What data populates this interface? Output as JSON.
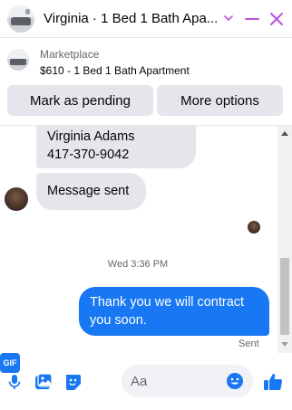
{
  "header": {
    "title": "Virginia · 1 Bed 1 Bath Apa...",
    "icons": [
      "chevron-down-icon",
      "minimize-icon",
      "close-icon"
    ],
    "accent_color": "#bc50e0"
  },
  "marketplace": {
    "label": "Marketplace",
    "item": "$610 - 1 Bed 1 Bath Apartment"
  },
  "actions": {
    "mark_pending": "Mark as pending",
    "more_options": "More options"
  },
  "messages": {
    "contact_name": "Virginia Adams",
    "contact_phone": "417-370-9042",
    "incoming": "Message sent",
    "timestamp": "Wed 3:36 PM",
    "outgoing": "Thank you we will contract you soon.",
    "status": "Sent"
  },
  "composer": {
    "placeholder": "Aa",
    "gif_label": "GIF",
    "icons": [
      "microphone-icon",
      "photo-icon",
      "sticker-icon",
      "gif-icon",
      "emoji-icon",
      "thumbs-up-icon"
    ],
    "accent_color": "#1877f2"
  }
}
